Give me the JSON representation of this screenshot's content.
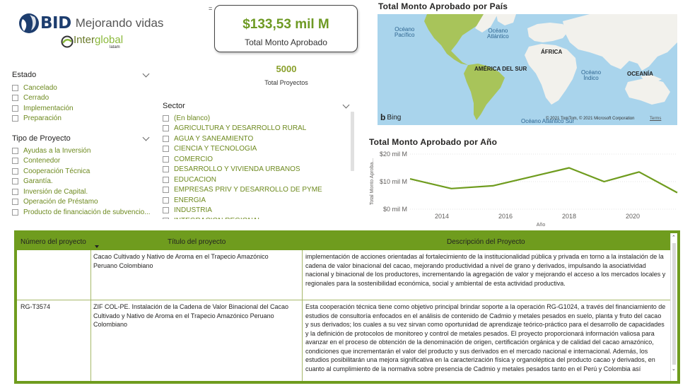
{
  "brand": {
    "bid_name": "BID",
    "bid_tagline": "Mejorando vidas",
    "partner_name_a": "Inter",
    "partner_name_b": "global",
    "partner_sub": "latam"
  },
  "kpis": {
    "monto_value": "$133,53 mil M",
    "monto_label": "Total Monto Aprobado",
    "proyectos_value": "5000",
    "proyectos_label": "Total Proyectos",
    "corner_mark": "="
  },
  "slicers": {
    "estado": {
      "title": "Estado",
      "options": [
        "Cancelado",
        "Cerrado",
        "Implementación",
        "Preparación"
      ]
    },
    "tipo": {
      "title": "Tipo de Proyecto",
      "options": [
        "Ayudas a la Inversión",
        "Contenedor",
        "Cooperación Técnica",
        "Garantía.",
        "Inversión de Capital.",
        "Operación de Préstamo",
        "Producto de financiación de subvencio..."
      ]
    },
    "sector": {
      "title": "Sector",
      "options": [
        "(En blanco)",
        "AGRICULTURA Y DESARROLLO RURAL",
        "AGUA Y SANEAMIENTO",
        "CIENCIA Y TECNOLOGIA",
        "COMERCIO",
        "DESARROLLO Y VIVIENDA URBANOS",
        "EDUCACION",
        "EMPRESAS PRIV Y DESARROLLO DE PYME",
        "ENERGIA",
        "INDUSTRIA",
        "INTEGRACION REGIONAL"
      ]
    }
  },
  "map": {
    "title": "Total Monto Aprobado por País",
    "labels": {
      "pacifico": "Océano\nPacífico",
      "atlantico": "Océano\nAtlántico",
      "africa": "ÁFRICA",
      "america_sur": "AMÉRICA DEL SUR",
      "indico": "Océano\nÍndico",
      "oceania": "OCEANÍA",
      "atlantico_sur": "Océano Atlántico Sur"
    },
    "bing": "Bing",
    "copyright": "© 2021 TomTom, © 2021 Microsoft Corporation",
    "terms": "Terms",
    "colors": {
      "water": "#a9d4ec",
      "land": "#f2f1ec",
      "highlight": "#a8c45a"
    }
  },
  "line_chart": {
    "title": "Total Monto Aprobado por Año"
  },
  "chart_data": {
    "type": "line",
    "title": "Total Monto Aprobado por Año",
    "xlabel": "Año",
    "ylabel": "Total Monto Aproba...",
    "x": [
      2013,
      2014,
      2015,
      2016,
      2017,
      2018,
      2019,
      2020,
      2021
    ],
    "series": [
      {
        "values": [
          11,
          7.5,
          8.5,
          12,
          15,
          10,
          13.5,
          6
        ]
      }
    ],
    "x_points": [
      2013,
      2014.3,
      2015.6,
      2016.9,
      2018,
      2019.1,
      2020.2,
      2021.4
    ],
    "xticks": [
      "2014",
      "2016",
      "2018",
      "2020"
    ],
    "yticks": [
      "$0 mil M",
      "$10 mil M",
      "$20 mil M"
    ],
    "ylim": [
      0,
      20
    ],
    "grid": true,
    "color": "#6f9c1e"
  },
  "table": {
    "headers": [
      "Número del proyecto",
      "Título del proyecto",
      "Descripción del Proyecto"
    ],
    "rows": [
      {
        "numero": "",
        "titulo": "Cacao Cultivado y Nativo de Aroma en el Trapecio Amazónico Peruano Colombiano",
        "descripcion": "implementación de acciones orientadas al fortalecimiento de la institucionalidad pública y privada en torno a la instalación de la cadena de valor binacional del cacao, mejorando productividad a nivel de grano y derivados, impulsando la asociatividad nacional y binacional de los productores, incrementando la agregación de valor y mejorando el acceso a los mercados locales y regionales para la sostenibilidad económica, social y ambiental de esta actividad productiva."
      },
      {
        "numero": "RG-T3574",
        "titulo": "ZIF COL-PE. Instalación de la Cadena de Valor Binacional del Cacao Cultivado y Nativo de Aroma en el Trapecio Amazónico Peruano Colombiano",
        "descripcion": "Esta cooperación técnica tiene como objetivo principal brindar soporte a la operación RG-G1024, a través del financiamiento de estudios de consultoría enfocados en el análisis de contenido de Cadmio y metales pesados en suelo, planta y fruto del cacao y sus derivados; los cuales a su vez sirvan como oportunidad de aprendizaje teórico-práctico para el desarrollo de capacidades y la definición de protocolos de monitoreo y control de metales pesados. El proyecto proporcionará información valiosa para avanzar en el proceso de obtención de la denominación de origen, certificación orgánica y de calidad del cacao amazónico, condiciones que incrementarán el valor del producto y sus derivados en el mercado nacional e internacional. Además, los estudios posibilitarán una mejora significativa en la caracterización física y organoléptica del producto cacao y derivados, en cuanto al cumplimiento de la normativa sobre presencia de Cadmio y metales pesados tanto en el Perú y Colombia así"
      }
    ]
  }
}
